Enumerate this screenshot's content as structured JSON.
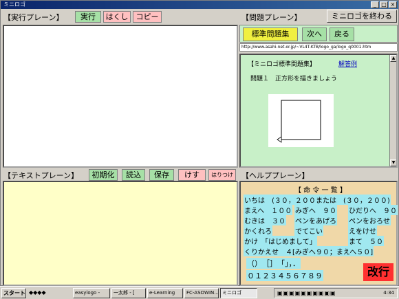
{
  "window": {
    "title": "ミニロゴ"
  },
  "exec": {
    "label": "【実行プレーン】",
    "run_label": "実行",
    "erase_label": "はくし",
    "copy_label": "コピー"
  },
  "problem": {
    "label": "【問題プレーン】",
    "quit_label": "ミニロゴを終わる",
    "standard_label": "標準問題集",
    "next_label": "次へ",
    "back_label": "戻る",
    "url": "http://www.asahi-net.or.jp/~VL4T-KTB/logo_ga/logo_q0001.htm",
    "heading": "【ミニロゴ標準問題集】",
    "answer_link": "解答例",
    "question": "問題１　正方形を描きましょう"
  },
  "text": {
    "label": "【テキストプレーン】",
    "init_label": "初期化",
    "read_label": "読込",
    "save_label": "保存",
    "clear_label": "けす",
    "paste_label": "はりつけ"
  },
  "help": {
    "label": "【ヘルププレーン】",
    "title": "【 命 令 一 覧 】",
    "r1a": "いちは　(３０，２００)",
    "r1b": "または　(３０，２００)",
    "r2a": "まえへ　１００",
    "r2b": "みぎへ　９０",
    "r2c": "ひだりへ　９０",
    "r3a": "むきは　３０",
    "r3b": "ペンをあげろ",
    "r3c": "ペンをおろせ",
    "r4a": "かくれろ",
    "r4b": "でてこい",
    "r4c": "えをけせ",
    "r5a": "かけ　「はじめまして」",
    "r5b": "まて　５０",
    "r6": "くりかえせ　４[みぎへ９０；まえへ５０]",
    "r7": "（）　［］　「」，．",
    "r8": "０１２３４５６７８９",
    "newline_label": "改行"
  },
  "taskbar": {
    "start_label": "スタート",
    "tasks": [
      "easylogo -",
      "一太郎 - [",
      "e-Learning",
      "FC-ASOWIN...",
      "ミニロゴ"
    ],
    "clock": "4:34"
  },
  "colors": {
    "exec_bg": "#ffffff",
    "text_bg": "#ffffc8",
    "problem_bg": "#c8f0c8",
    "help_bg": "#f0d8a8",
    "newline_red": "#ff3030"
  }
}
